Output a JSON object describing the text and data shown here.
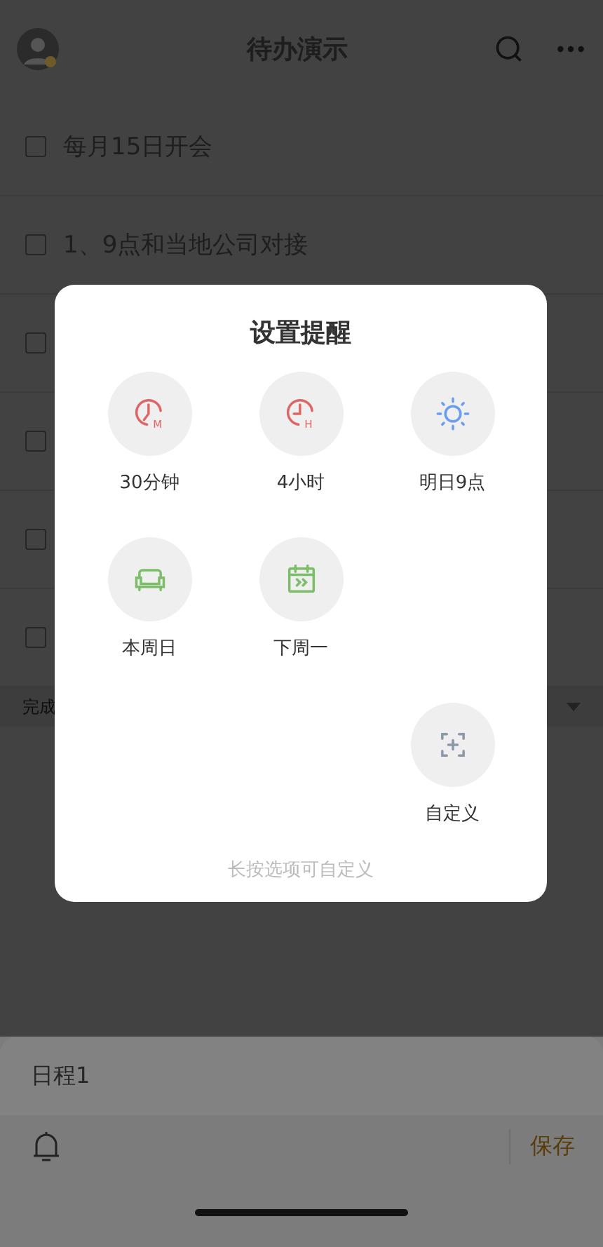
{
  "header": {
    "title": "待办演示"
  },
  "todos": [
    {
      "title": "每月15日开会",
      "checked": false
    },
    {
      "title": "1、9点和当地公司对接",
      "checked": false
    },
    {
      "checked": false
    },
    {
      "checked": false
    },
    {
      "checked": false
    },
    {
      "checked": false
    }
  ],
  "done_section": {
    "label": "完成"
  },
  "reminder_dialog": {
    "title": "设置提醒",
    "options": [
      {
        "kind": "minutes",
        "label": "30分钟",
        "icon_letter": "M"
      },
      {
        "kind": "hours",
        "label": "4小时",
        "icon_letter": "H"
      },
      {
        "kind": "morning",
        "label": "明日9点"
      },
      {
        "kind": "weekend",
        "label": "本周日"
      },
      {
        "kind": "next_week",
        "label": "下周一"
      },
      {
        "kind": "custom",
        "label": "自定义"
      }
    ],
    "hint": "长按选项可自定义"
  },
  "composer": {
    "value": "日程1",
    "save": "保存"
  }
}
